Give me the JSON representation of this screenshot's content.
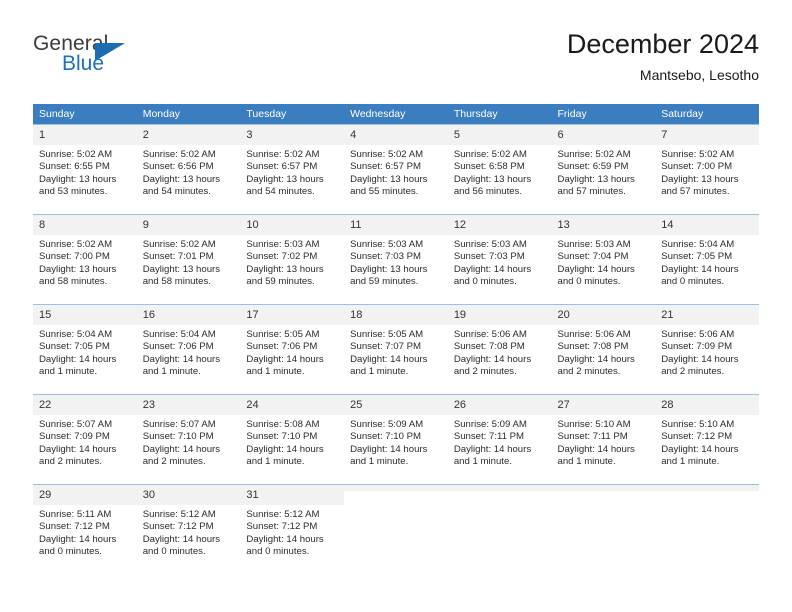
{
  "brand": {
    "line1": "General",
    "line2": "Blue",
    "triangle_color": "#1b6cb3"
  },
  "header": {
    "title": "December 2024",
    "location": "Mantsebo, Lesotho"
  },
  "theme": {
    "header_bar": "#3a7ebf",
    "daynum_bg": "#f2f2f2",
    "grid_line": "#9ebfdd",
    "text": "#2b2b2b"
  },
  "weekday_headers": [
    "Sunday",
    "Monday",
    "Tuesday",
    "Wednesday",
    "Thursday",
    "Friday",
    "Saturday"
  ],
  "weeks": [
    [
      {
        "day": "1",
        "sunrise": "Sunrise: 5:02 AM",
        "sunset": "Sunset: 6:55 PM",
        "daylight1": "Daylight: 13 hours",
        "daylight2": "and 53 minutes."
      },
      {
        "day": "2",
        "sunrise": "Sunrise: 5:02 AM",
        "sunset": "Sunset: 6:56 PM",
        "daylight1": "Daylight: 13 hours",
        "daylight2": "and 54 minutes."
      },
      {
        "day": "3",
        "sunrise": "Sunrise: 5:02 AM",
        "sunset": "Sunset: 6:57 PM",
        "daylight1": "Daylight: 13 hours",
        "daylight2": "and 54 minutes."
      },
      {
        "day": "4",
        "sunrise": "Sunrise: 5:02 AM",
        "sunset": "Sunset: 6:57 PM",
        "daylight1": "Daylight: 13 hours",
        "daylight2": "and 55 minutes."
      },
      {
        "day": "5",
        "sunrise": "Sunrise: 5:02 AM",
        "sunset": "Sunset: 6:58 PM",
        "daylight1": "Daylight: 13 hours",
        "daylight2": "and 56 minutes."
      },
      {
        "day": "6",
        "sunrise": "Sunrise: 5:02 AM",
        "sunset": "Sunset: 6:59 PM",
        "daylight1": "Daylight: 13 hours",
        "daylight2": "and 57 minutes."
      },
      {
        "day": "7",
        "sunrise": "Sunrise: 5:02 AM",
        "sunset": "Sunset: 7:00 PM",
        "daylight1": "Daylight: 13 hours",
        "daylight2": "and 57 minutes."
      }
    ],
    [
      {
        "day": "8",
        "sunrise": "Sunrise: 5:02 AM",
        "sunset": "Sunset: 7:00 PM",
        "daylight1": "Daylight: 13 hours",
        "daylight2": "and 58 minutes."
      },
      {
        "day": "9",
        "sunrise": "Sunrise: 5:02 AM",
        "sunset": "Sunset: 7:01 PM",
        "daylight1": "Daylight: 13 hours",
        "daylight2": "and 58 minutes."
      },
      {
        "day": "10",
        "sunrise": "Sunrise: 5:03 AM",
        "sunset": "Sunset: 7:02 PM",
        "daylight1": "Daylight: 13 hours",
        "daylight2": "and 59 minutes."
      },
      {
        "day": "11",
        "sunrise": "Sunrise: 5:03 AM",
        "sunset": "Sunset: 7:03 PM",
        "daylight1": "Daylight: 13 hours",
        "daylight2": "and 59 minutes."
      },
      {
        "day": "12",
        "sunrise": "Sunrise: 5:03 AM",
        "sunset": "Sunset: 7:03 PM",
        "daylight1": "Daylight: 14 hours",
        "daylight2": "and 0 minutes."
      },
      {
        "day": "13",
        "sunrise": "Sunrise: 5:03 AM",
        "sunset": "Sunset: 7:04 PM",
        "daylight1": "Daylight: 14 hours",
        "daylight2": "and 0 minutes."
      },
      {
        "day": "14",
        "sunrise": "Sunrise: 5:04 AM",
        "sunset": "Sunset: 7:05 PM",
        "daylight1": "Daylight: 14 hours",
        "daylight2": "and 0 minutes."
      }
    ],
    [
      {
        "day": "15",
        "sunrise": "Sunrise: 5:04 AM",
        "sunset": "Sunset: 7:05 PM",
        "daylight1": "Daylight: 14 hours",
        "daylight2": "and 1 minute."
      },
      {
        "day": "16",
        "sunrise": "Sunrise: 5:04 AM",
        "sunset": "Sunset: 7:06 PM",
        "daylight1": "Daylight: 14 hours",
        "daylight2": "and 1 minute."
      },
      {
        "day": "17",
        "sunrise": "Sunrise: 5:05 AM",
        "sunset": "Sunset: 7:06 PM",
        "daylight1": "Daylight: 14 hours",
        "daylight2": "and 1 minute."
      },
      {
        "day": "18",
        "sunrise": "Sunrise: 5:05 AM",
        "sunset": "Sunset: 7:07 PM",
        "daylight1": "Daylight: 14 hours",
        "daylight2": "and 1 minute."
      },
      {
        "day": "19",
        "sunrise": "Sunrise: 5:06 AM",
        "sunset": "Sunset: 7:08 PM",
        "daylight1": "Daylight: 14 hours",
        "daylight2": "and 2 minutes."
      },
      {
        "day": "20",
        "sunrise": "Sunrise: 5:06 AM",
        "sunset": "Sunset: 7:08 PM",
        "daylight1": "Daylight: 14 hours",
        "daylight2": "and 2 minutes."
      },
      {
        "day": "21",
        "sunrise": "Sunrise: 5:06 AM",
        "sunset": "Sunset: 7:09 PM",
        "daylight1": "Daylight: 14 hours",
        "daylight2": "and 2 minutes."
      }
    ],
    [
      {
        "day": "22",
        "sunrise": "Sunrise: 5:07 AM",
        "sunset": "Sunset: 7:09 PM",
        "daylight1": "Daylight: 14 hours",
        "daylight2": "and 2 minutes."
      },
      {
        "day": "23",
        "sunrise": "Sunrise: 5:07 AM",
        "sunset": "Sunset: 7:10 PM",
        "daylight1": "Daylight: 14 hours",
        "daylight2": "and 2 minutes."
      },
      {
        "day": "24",
        "sunrise": "Sunrise: 5:08 AM",
        "sunset": "Sunset: 7:10 PM",
        "daylight1": "Daylight: 14 hours",
        "daylight2": "and 1 minute."
      },
      {
        "day": "25",
        "sunrise": "Sunrise: 5:09 AM",
        "sunset": "Sunset: 7:10 PM",
        "daylight1": "Daylight: 14 hours",
        "daylight2": "and 1 minute."
      },
      {
        "day": "26",
        "sunrise": "Sunrise: 5:09 AM",
        "sunset": "Sunset: 7:11 PM",
        "daylight1": "Daylight: 14 hours",
        "daylight2": "and 1 minute."
      },
      {
        "day": "27",
        "sunrise": "Sunrise: 5:10 AM",
        "sunset": "Sunset: 7:11 PM",
        "daylight1": "Daylight: 14 hours",
        "daylight2": "and 1 minute."
      },
      {
        "day": "28",
        "sunrise": "Sunrise: 5:10 AM",
        "sunset": "Sunset: 7:12 PM",
        "daylight1": "Daylight: 14 hours",
        "daylight2": "and 1 minute."
      }
    ],
    [
      {
        "day": "29",
        "sunrise": "Sunrise: 5:11 AM",
        "sunset": "Sunset: 7:12 PM",
        "daylight1": "Daylight: 14 hours",
        "daylight2": "and 0 minutes."
      },
      {
        "day": "30",
        "sunrise": "Sunrise: 5:12 AM",
        "sunset": "Sunset: 7:12 PM",
        "daylight1": "Daylight: 14 hours",
        "daylight2": "and 0 minutes."
      },
      {
        "day": "31",
        "sunrise": "Sunrise: 5:12 AM",
        "sunset": "Sunset: 7:12 PM",
        "daylight1": "Daylight: 14 hours",
        "daylight2": "and 0 minutes."
      },
      {
        "day": "",
        "sunrise": "",
        "sunset": "",
        "daylight1": "",
        "daylight2": ""
      },
      {
        "day": "",
        "sunrise": "",
        "sunset": "",
        "daylight1": "",
        "daylight2": ""
      },
      {
        "day": "",
        "sunrise": "",
        "sunset": "",
        "daylight1": "",
        "daylight2": ""
      },
      {
        "day": "",
        "sunrise": "",
        "sunset": "",
        "daylight1": "",
        "daylight2": ""
      }
    ]
  ]
}
